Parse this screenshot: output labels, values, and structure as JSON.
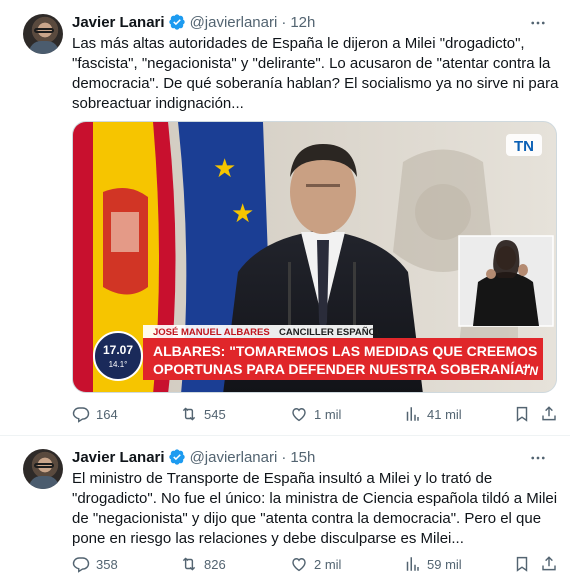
{
  "tweets": [
    {
      "author": "Javier Lanari",
      "handle": "@javierlanari",
      "time": "12h",
      "text": "Las más altas autoridades de España le dijeron a Milei \"drogadicto\", \"fascista\", \"negacionista\" y \"delirante\". Lo acusaron de \"atentar contra la democracia\". De qué soberanía hablan? El socialismo ya no sirve ni para sobreactuar indignación...",
      "media": {
        "channel_logo": "TN",
        "lower_third_name": "JOSÉ MANUEL ALBARES",
        "lower_third_role": "CANCILLER ESPAÑOL",
        "headline_line1": "ALBARES: \"TOMAREMOS LAS MEDIDAS QUE CREEMOS",
        "headline_line2": "OPORTUNAS PARA DEFENDER NUESTRA SOBERANÍA\"",
        "clock_time": "17.07",
        "clock_temp": "14.1°"
      },
      "replies": "164",
      "reposts": "545",
      "likes": "1 mil",
      "views": "41 mil"
    },
    {
      "author": "Javier Lanari",
      "handle": "@javierlanari",
      "time": "15h",
      "text": "El ministro de Transporte de España insultó a Milei y lo trató de \"drogadicto\". No fue el único: la ministra de Ciencia española tildó a Milei de \"negacionista\" y dijo que \"atenta contra la democracia\". Pero el que pone en riesgo las relaciones y debe disculparse es Milei...",
      "replies": "358",
      "reposts": "826",
      "likes": "2 mil",
      "views": "59 mil"
    }
  ],
  "colors": {
    "text": "#0f1419",
    "secondary": "#536471",
    "verified": "#1d9bf0",
    "banner_red": "#e0262a"
  }
}
